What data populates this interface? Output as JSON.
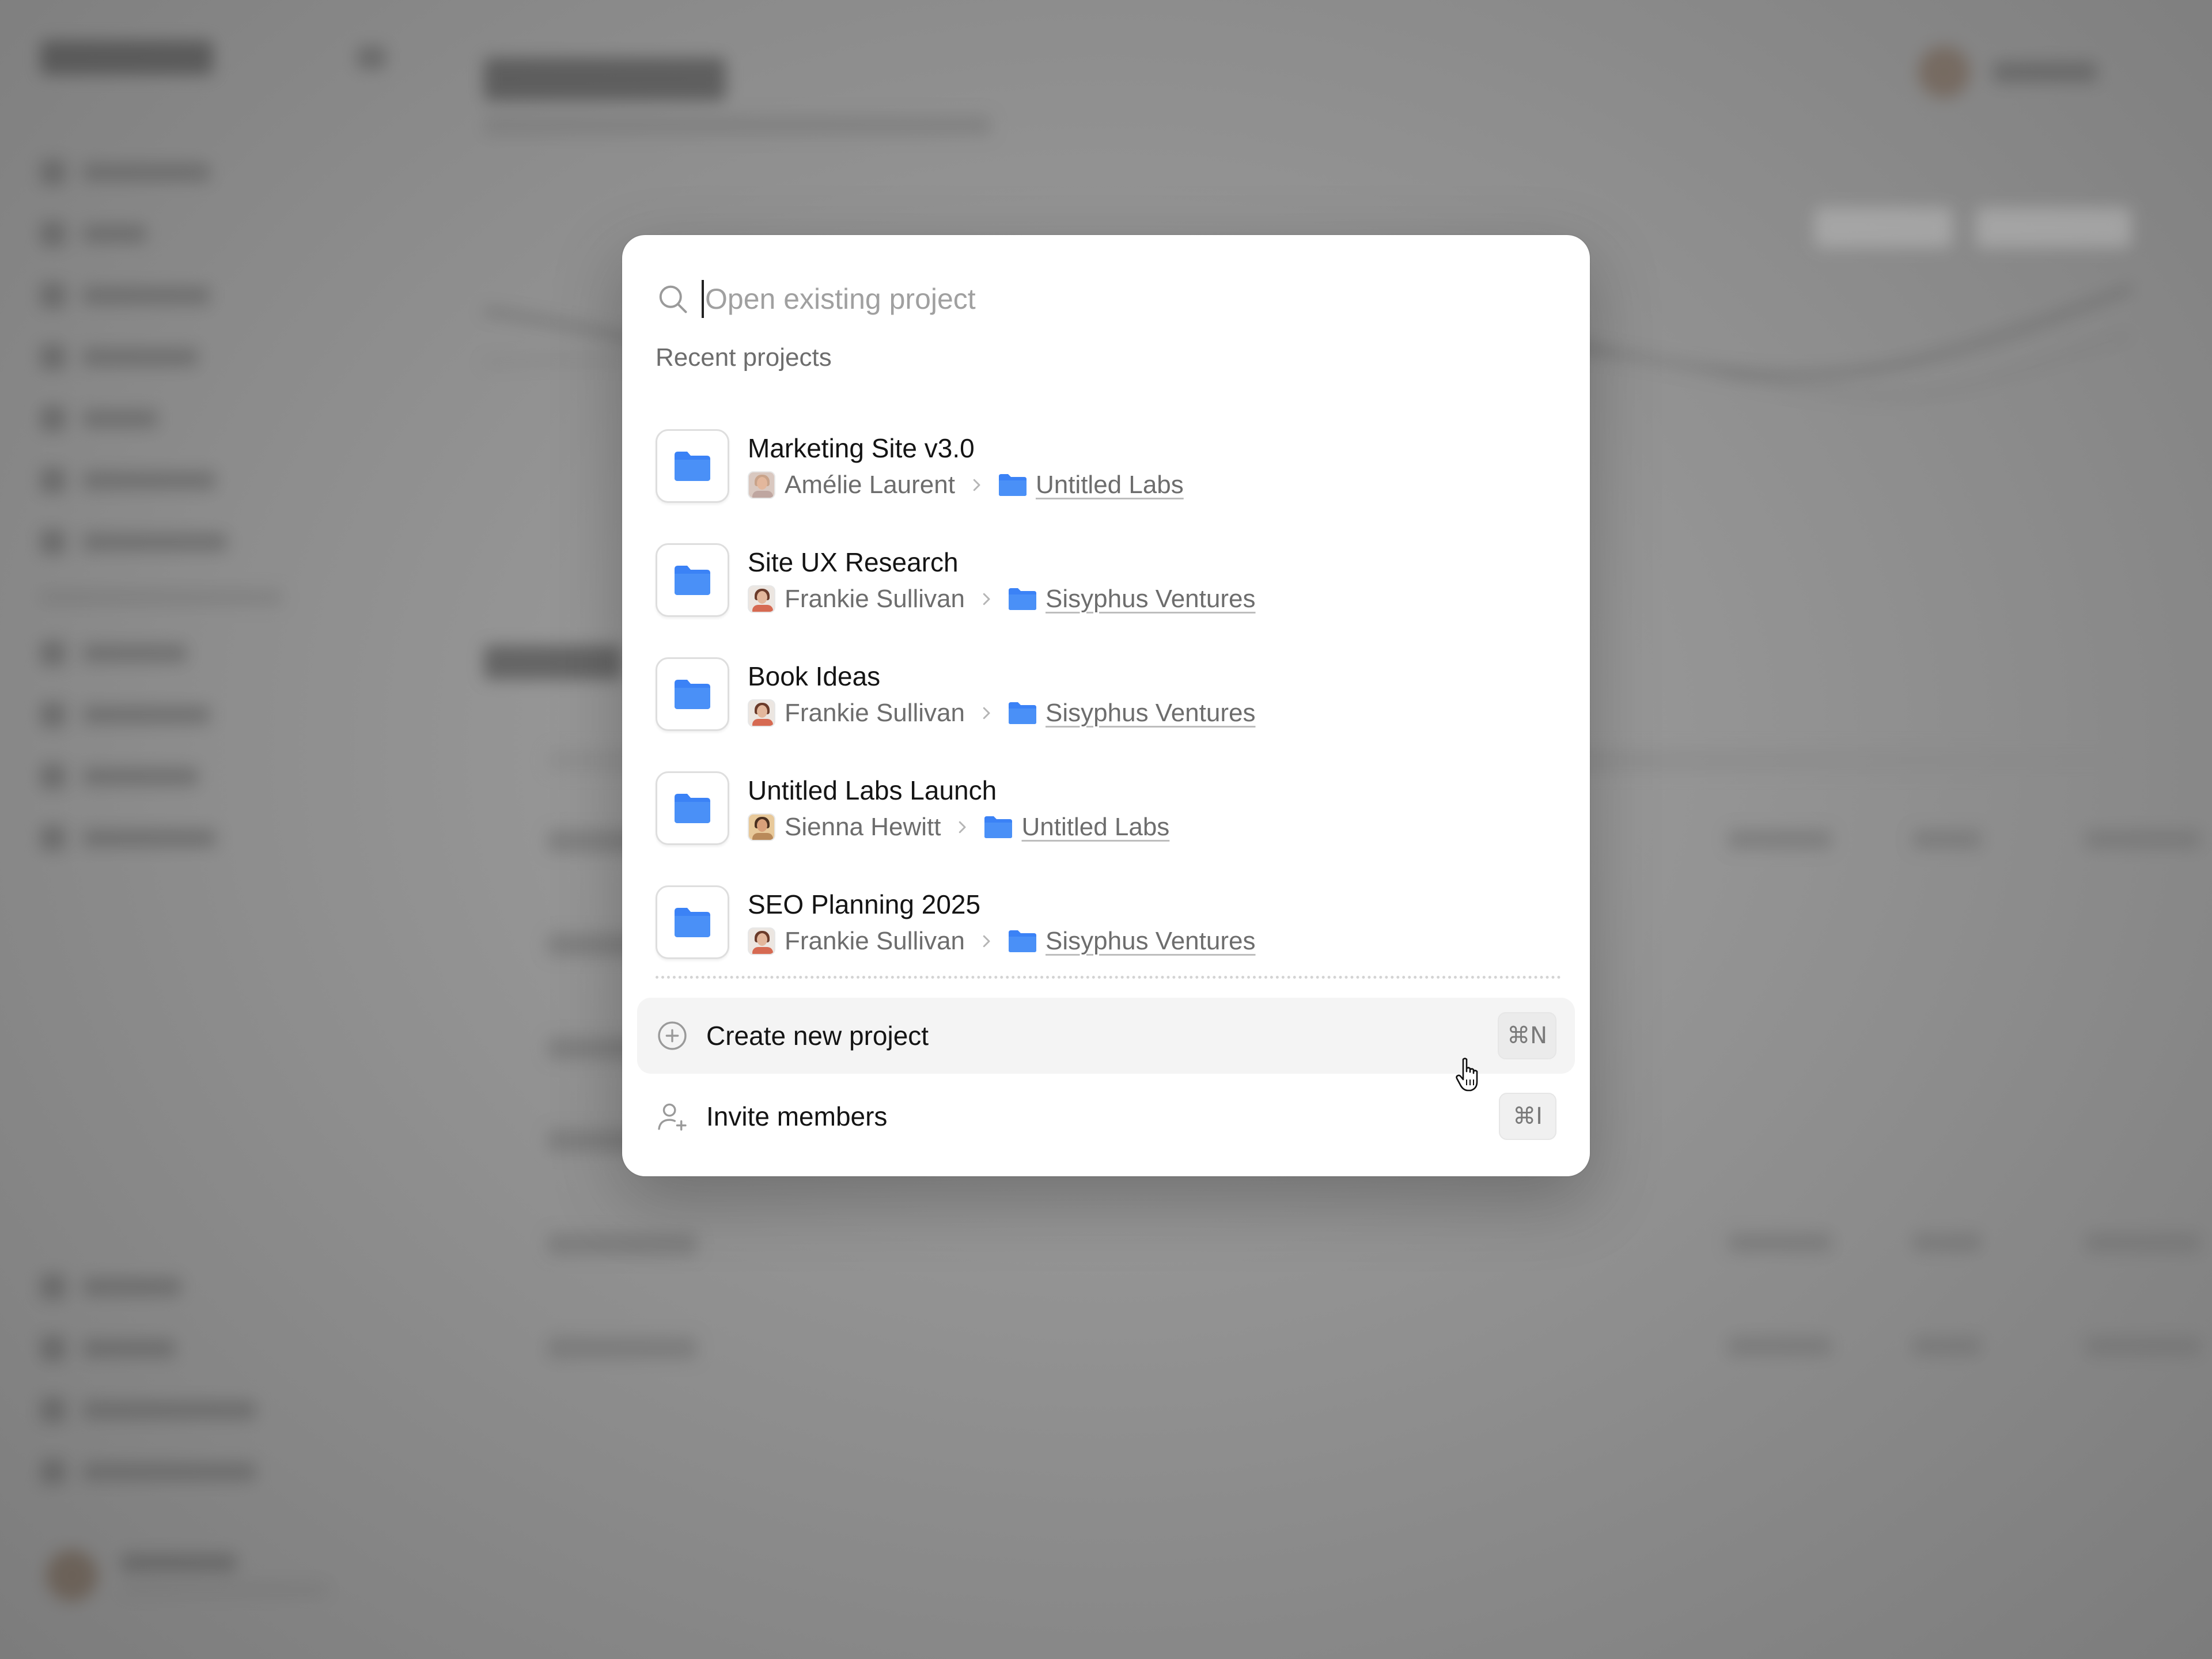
{
  "modal": {
    "search": {
      "placeholder": "Open existing project"
    },
    "section_label": "Recent projects",
    "projects": [
      {
        "name": "Marketing Site v3.0",
        "owner": "Amélie Laurent",
        "org": "Untitled Labs",
        "icon": "folder-icon"
      },
      {
        "name": "Site UX Research",
        "owner": "Frankie Sullivan",
        "org": "Sisyphus Ventures",
        "icon": "folder-icon"
      },
      {
        "name": "Book Ideas",
        "owner": "Frankie Sullivan",
        "org": "Sisyphus Ventures",
        "icon": "folder-icon"
      },
      {
        "name": "Untitled Labs Launch",
        "owner": "Sienna Hewitt",
        "org": "Untitled Labs",
        "icon": "folder-icon"
      },
      {
        "name": "SEO Planning 2025",
        "owner": "Frankie Sullivan",
        "org": "Sisyphus Ventures",
        "icon": "folder-icon"
      }
    ],
    "actions": {
      "create": {
        "label": "Create new project",
        "shortcut": "⌘N",
        "icon": "plus-circle-icon"
      },
      "invite": {
        "label": "Invite members",
        "shortcut": "⌘I",
        "icon": "user-plus-icon"
      }
    }
  },
  "colors": {
    "accent_folder": "#3b82f6",
    "backdrop": "#8e8e8e",
    "modal_bg": "#ffffff",
    "hover_row": "#f4f4f4"
  }
}
